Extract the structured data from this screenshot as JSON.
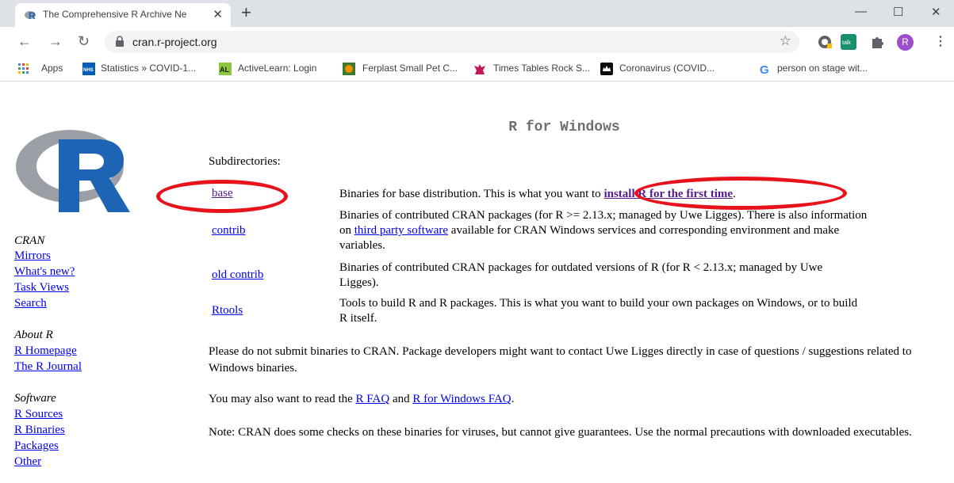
{
  "browser": {
    "tab_title": "The Comprehensive R Archive Ne",
    "tab_close": "✕",
    "new_tab": "+",
    "min": "—",
    "max": "☐",
    "close": "✕",
    "url": "cran.r-project.org",
    "avatar_letter": "R",
    "ext_talk": "talk",
    "bookmarks": {
      "apps": "Apps",
      "b1": "Statistics » COVID-1...",
      "b2": "ActiveLearn: Login",
      "b3": "Ferplast Small Pet C...",
      "b4": "Times Tables Rock S...",
      "b5": "Coronavirus (COVID...",
      "b6": "person on stage wit..."
    }
  },
  "page": {
    "title": "R for Windows",
    "sidebar": {
      "cran_head": "CRAN",
      "mirrors": "Mirrors",
      "whats_new": "What's new?",
      "task_views": "Task Views",
      "search": "Search",
      "about_head": "About R",
      "homepage": "R Homepage",
      "journal": "The R Journal",
      "software_head": "Software",
      "sources": "R Sources",
      "binaries": "R Binaries",
      "packages": "Packages",
      "other": "Other"
    },
    "subdirectories_label": "Subdirectories:",
    "rows": {
      "base_link": "base",
      "base_desc_pre": "Binaries for base distribution. This is what you want to ",
      "base_desc_link": "install R for the first time",
      "base_desc_post": ".",
      "contrib_link": "contrib",
      "contrib_desc_pre": "Binaries of contributed CRAN packages (for R >= 2.13.x; managed by Uwe Ligges). There is also information on ",
      "contrib_desc_link": "third party software",
      "contrib_desc_post": " available for CRAN Windows services and corresponding environment and make variables.",
      "old_link": "old contrib",
      "old_desc": "Binaries of contributed CRAN packages for outdated versions of R (for R < 2.13.x; managed by Uwe Ligges).",
      "rtools_link": "Rtools",
      "rtools_desc": "Tools to build R and R packages. This is what you want to build your own packages on Windows, or to build R itself."
    },
    "para1": "Please do not submit binaries to CRAN. Package developers might want to contact Uwe Ligges directly in case of questions / suggestions related to Windows binaries.",
    "para2_pre": "You may also want to read the ",
    "para2_link1": "R FAQ",
    "para2_mid": " and ",
    "para2_link2": "R for Windows FAQ",
    "para2_post": ".",
    "para3": "Note: CRAN does some checks on these binaries for viruses, but cannot give guarantees. Use the normal precautions with downloaded executables."
  },
  "colors": {
    "annotation": "#e8121b",
    "link": "#0000ee",
    "visited": "#551a8b"
  }
}
